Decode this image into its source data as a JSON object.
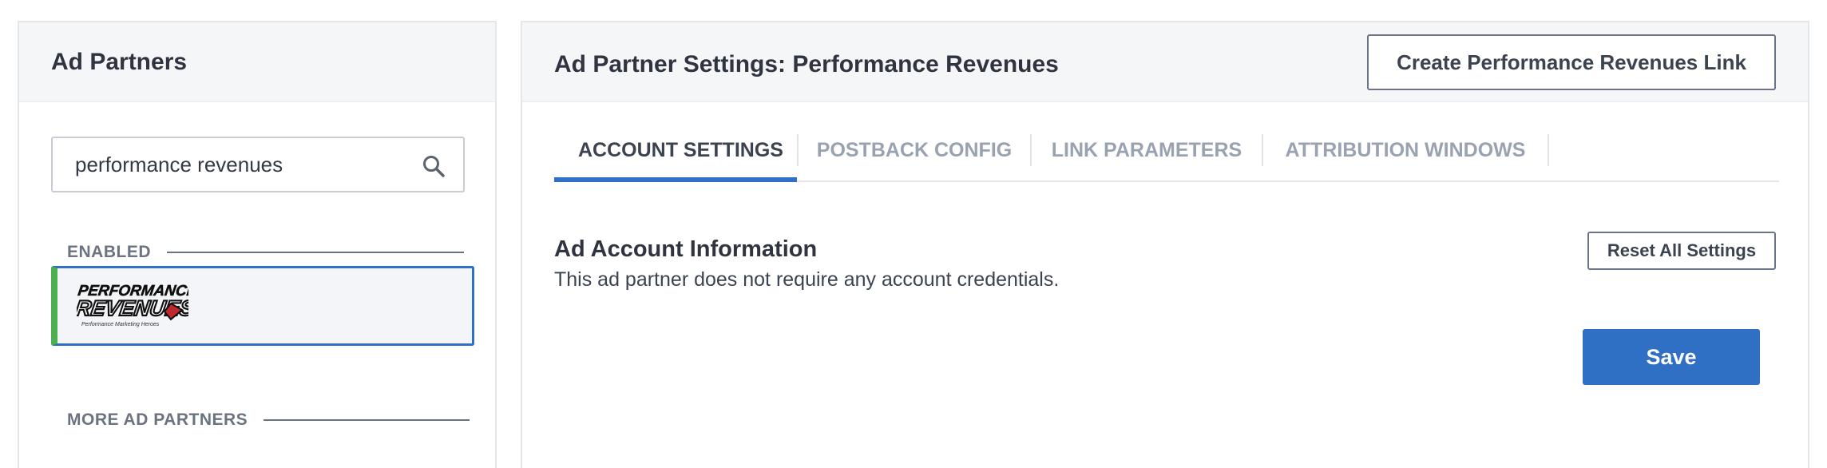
{
  "sidebar": {
    "title": "Ad Partners",
    "search": {
      "value": "performance revenues",
      "placeholder": ""
    },
    "enabled_label": "ENABLED",
    "more_label": "MORE AD PARTNERS",
    "partners": [
      {
        "name": "Performance Revenues",
        "logo_text_line1": "PERFORMANCE",
        "logo_text_line2": "REVENUES",
        "logo_tagline": "Performance Marketing Heroes",
        "status_color": "#4caf50"
      }
    ]
  },
  "main": {
    "title": "Ad Partner Settings: Performance Revenues",
    "create_link_label": "Create Performance Revenues Link",
    "tabs": [
      {
        "label": "ACCOUNT SETTINGS",
        "active": true
      },
      {
        "label": "POSTBACK CONFIG",
        "active": false
      },
      {
        "label": "LINK PARAMETERS",
        "active": false
      },
      {
        "label": "ATTRIBUTION WINDOWS",
        "active": false
      }
    ],
    "section_title": "Ad Account Information",
    "section_desc": "This ad partner does not require any account credentials.",
    "reset_label": "Reset All Settings",
    "save_label": "Save"
  },
  "colors": {
    "accent": "#2f6fc4",
    "enabled": "#4caf50"
  }
}
